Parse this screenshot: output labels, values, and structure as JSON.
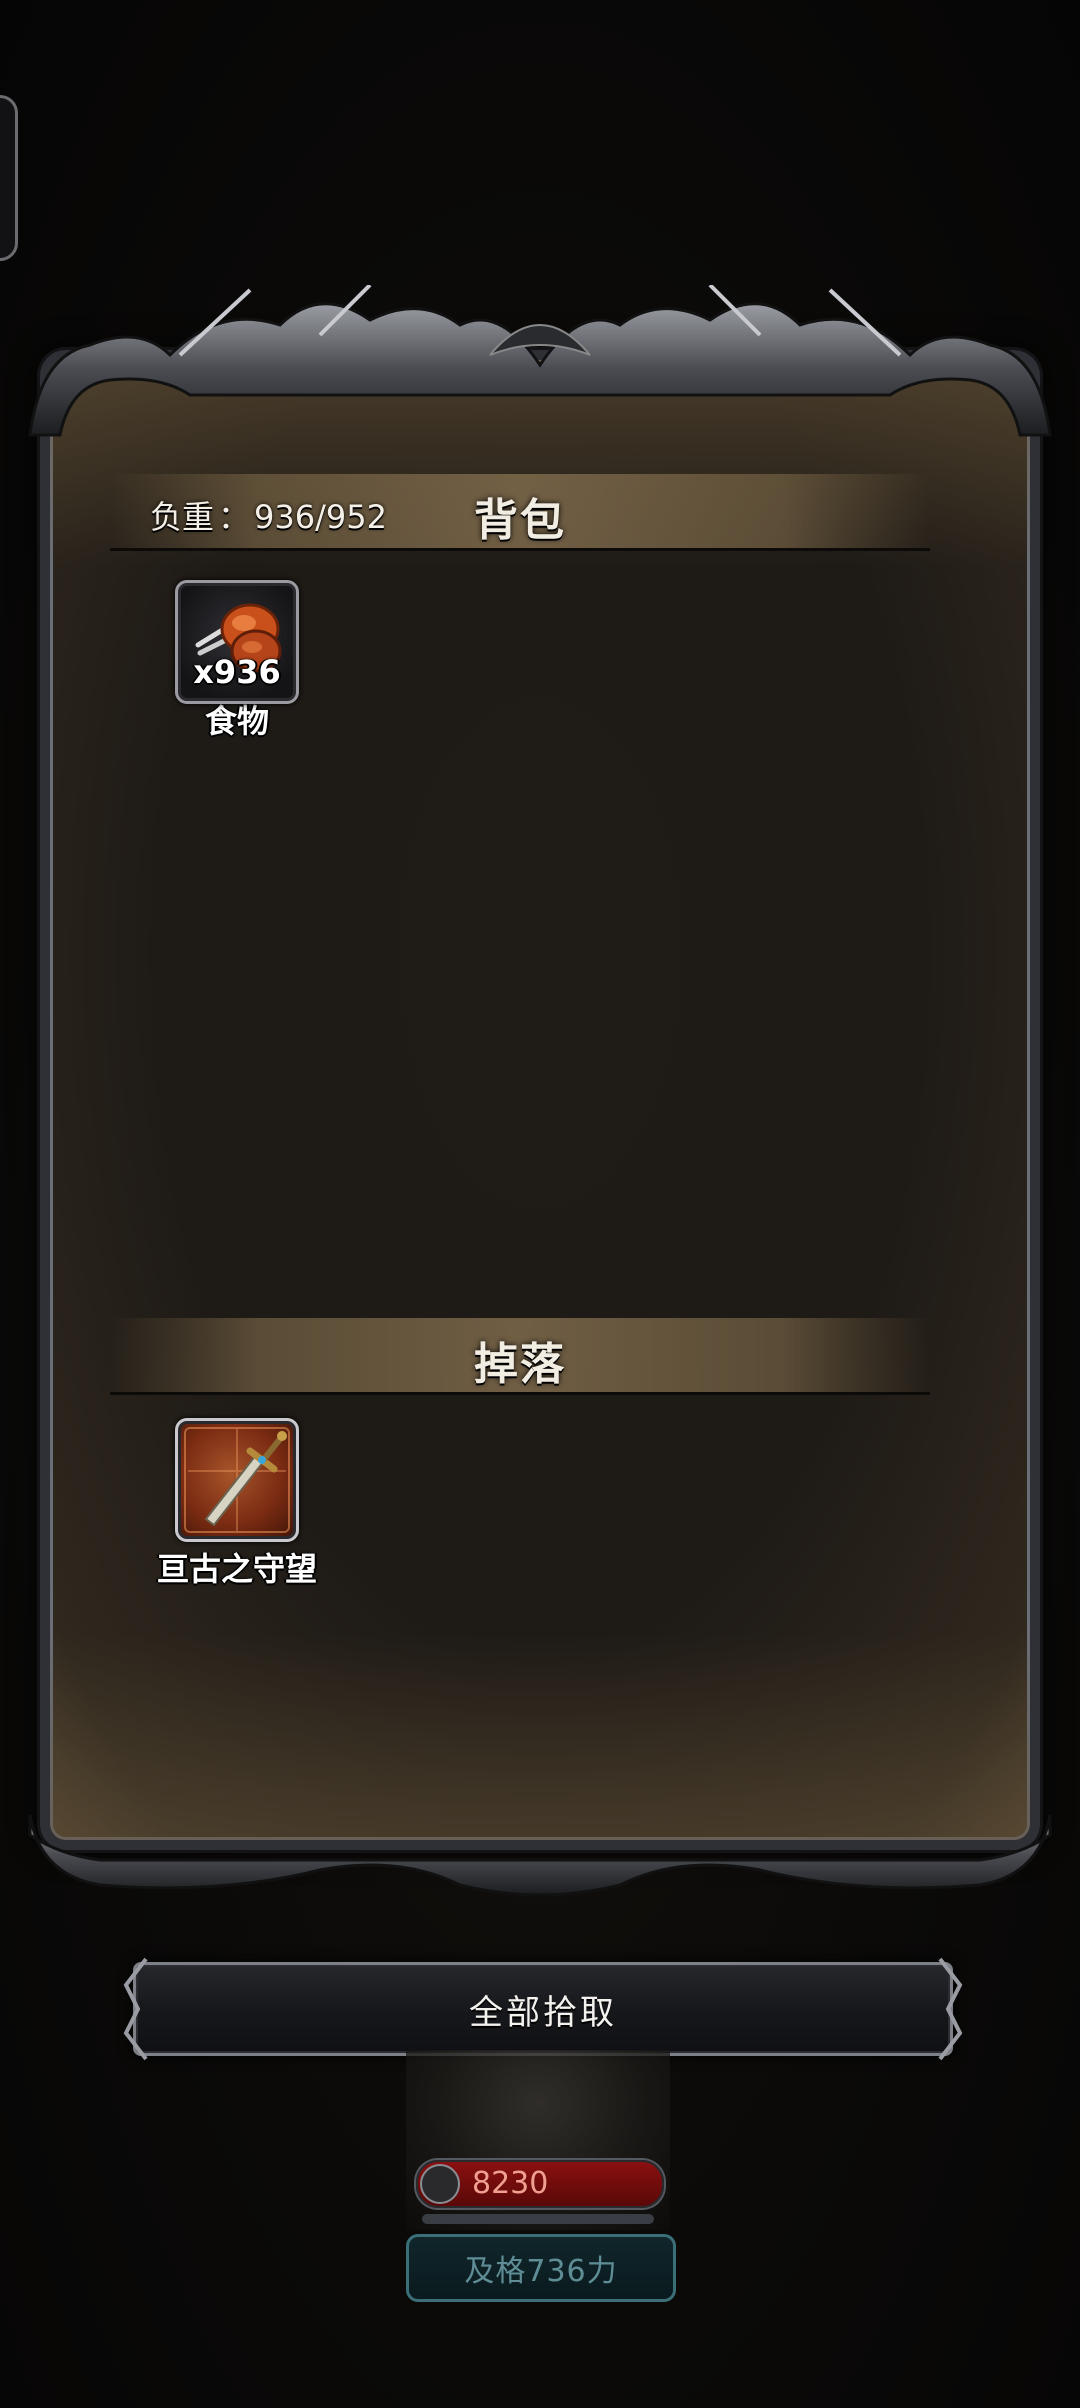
{
  "backpack": {
    "title": "背包",
    "weight_label": "负重",
    "weight_separator": "：",
    "weight_value": "936/952",
    "items": [
      {
        "name": "食物",
        "count": "x936",
        "icon": "roasted-meat-icon"
      }
    ]
  },
  "drops": {
    "title": "掉落",
    "items": [
      {
        "name": "亘古之守望",
        "icon": "sword-icon",
        "rarity_color": "#8a3416"
      }
    ]
  },
  "actions": {
    "pickup_all_label": "全部拾取"
  },
  "player": {
    "power_value": "8230",
    "power_icon": "sword-icon",
    "requirement_label": "及格736力"
  }
}
